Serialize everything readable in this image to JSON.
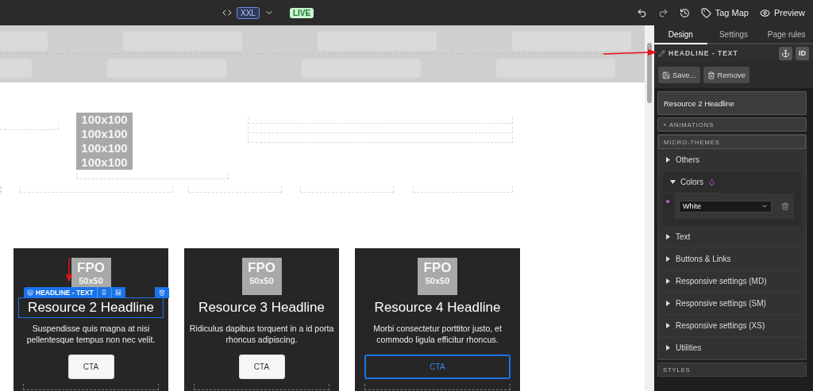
{
  "toolbar": {
    "breakpoint": "XXL",
    "status": "LIVE",
    "actions": [
      {
        "kind": "tag",
        "label": "Tag Map"
      },
      {
        "kind": "preview",
        "label": "Preview"
      }
    ]
  },
  "canvas": {
    "placeholder_lines": [
      "100x100",
      "100x100",
      "100x100",
      "100x100"
    ],
    "selection_toolbar": {
      "label": "HEADLINE - TEXT"
    },
    "cards": [
      {
        "fpo": "FPO",
        "fpo_size": "50x50",
        "headline": "Resource 2 Headline",
        "text": "Suspendisse quis magna at nisi pellentesque tempus non nec velit.",
        "cta": "CTA",
        "selected": true,
        "cta_selected": false
      },
      {
        "fpo": "FPO",
        "fpo_size": "50x50",
        "headline": "Resource 3 Headline",
        "text": "Ridiculus dapibus torquent in a id porta rhoncus adipiscing.",
        "cta": "CTA",
        "selected": false,
        "cta_selected": false
      },
      {
        "fpo": "FPO",
        "fpo_size": "50x50",
        "headline": "Resource 4 Headline",
        "text": "Morbi consectetur porttitor justo, et commodo ligula efficitur rhoncus.",
        "cta": "CTA",
        "selected": false,
        "cta_selected": true
      }
    ]
  },
  "panel": {
    "tabs": [
      {
        "label": "Design",
        "selected": true
      },
      {
        "label": "Settings",
        "selected": false
      },
      {
        "label": "Page rules",
        "selected": false
      }
    ],
    "element_label": "HEADLINE - TEXT",
    "id_button": "ID",
    "buttons": [
      {
        "kind": "save",
        "label": "Save..."
      },
      {
        "kind": "remove",
        "label": "Remove"
      }
    ],
    "name_value": "Resource 2 Headline",
    "animations": "+ ANIMATIONS",
    "micro_themes_title": "MICRO-THEMES",
    "micro_themes": [
      {
        "label": "Others",
        "expanded": false
      },
      {
        "label": "Colors",
        "expanded": true,
        "entries": [
          {
            "value": "White",
            "color": "#c35ee0"
          }
        ]
      },
      {
        "label": "Text",
        "expanded": false
      },
      {
        "label": "Buttons & Links",
        "expanded": false
      },
      {
        "label": "Responsive settings (MD)",
        "expanded": false
      },
      {
        "label": "Responsive settings (SM)",
        "expanded": false
      },
      {
        "label": "Responsive settings (XS)",
        "expanded": false
      },
      {
        "label": "Utilities",
        "expanded": false
      }
    ],
    "styles_title": "STYLES"
  }
}
